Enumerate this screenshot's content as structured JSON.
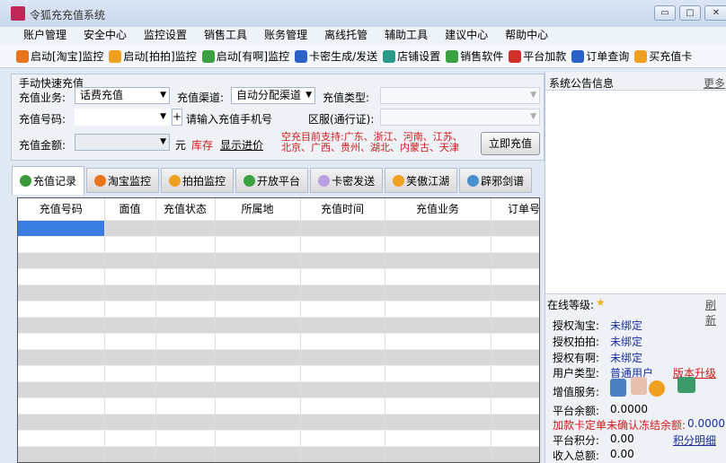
{
  "window": {
    "title": "令狐充充值系统",
    "minimize": "▭",
    "maximize": "▢",
    "close": "✕"
  },
  "menu": [
    "账户管理",
    "安全中心",
    "监控设置",
    "销售工具",
    "账务管理",
    "离线托管",
    "辅助工具",
    "建议中心",
    "帮助中心"
  ],
  "toolbar": [
    {
      "label": "启动[淘宝]监控",
      "icon": "taobao-icon",
      "color": "#e8731a"
    },
    {
      "label": "启动[拍拍]监控",
      "icon": "paipai-icon",
      "color": "#f0a020"
    },
    {
      "label": "启动[有啊]监控",
      "icon": "youa-icon",
      "color": "#3aa040"
    },
    {
      "label": "卡密生成/发送",
      "icon": "card-icon",
      "color": "#2a62c8"
    },
    {
      "label": "店铺设置",
      "icon": "shop-icon",
      "color": "#2a9a8a"
    },
    {
      "label": "销售软件",
      "icon": "users-icon",
      "color": "#3aa040"
    },
    {
      "label": "平台加款",
      "icon": "money-icon",
      "color": "#d0302a"
    },
    {
      "label": "订单查询",
      "icon": "chart-icon",
      "color": "#2a62c8"
    },
    {
      "label": "买充值卡",
      "icon": "buy-card-icon",
      "color": "#f0a020"
    }
  ],
  "form": {
    "legend": "手动快速充值",
    "business_label": "充值业务:",
    "business_value": "话费充值",
    "channel_label": "充值渠道:",
    "channel_value": "自动分配渠道",
    "type_label": "充值类型:",
    "number_label": "充值号码:",
    "plus": "+",
    "number_hint": "请输入充值手机号",
    "zone_label": "区服(通行证):",
    "amount_label": "充值金额:",
    "unit": "元",
    "stock": "库存",
    "show_price": "显示进价",
    "support_line1": "空充目前支持:广东、浙江、河南、江苏、",
    "support_line2": "北京、广西、贵州、湖北、内蒙古、天津",
    "submit": "立即充值"
  },
  "tabs": [
    {
      "label": "充值记录",
      "color": "#3a9a3a"
    },
    {
      "label": "淘宝监控",
      "color": "#e8731a"
    },
    {
      "label": "拍拍监控",
      "color": "#f0a020"
    },
    {
      "label": "开放平台",
      "color": "#3aa040"
    },
    {
      "label": "卡密发送",
      "color": "#b8a0e0"
    },
    {
      "label": "笑傲江湖",
      "color": "#f0a020"
    },
    {
      "label": "辟邪剑谱",
      "color": "#4a90d0"
    }
  ],
  "grid": {
    "columns": [
      "充值号码",
      "面值",
      "充值状态",
      "所属地",
      "充值时间",
      "充值业务",
      "订单号"
    ]
  },
  "right": {
    "notice_title": "系统公告信息",
    "more": "更多",
    "level_label": "在线等级:",
    "refresh": "刷新",
    "auth_taobao_label": "授权淘宝:",
    "auth_taobao": "未绑定",
    "auth_paipai_label": "授权拍拍:",
    "auth_paipai": "未绑定",
    "auth_youa_label": "授权有啊:",
    "auth_youa": "未绑定",
    "user_type_label": "用户类型:",
    "user_type": "普通用户",
    "upgrade": "版本升级",
    "vas_label": "增值服务:",
    "balance_label": "平台余额:",
    "balance": "0.0000",
    "frozen_label": "加款卡定单未确认冻结余额:",
    "frozen": "0.0000",
    "points_label": "平台积分:",
    "points": "0.00",
    "points_detail": "积分明细",
    "income_label": "收入总额:",
    "income": "0.00"
  }
}
